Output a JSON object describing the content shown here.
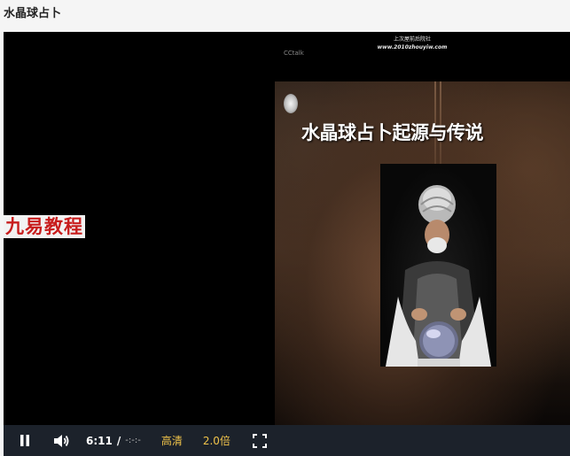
{
  "page": {
    "title": "水晶球占卜"
  },
  "slide": {
    "header_line1": "上次屋前后院社",
    "header_url": "www.2010zhouyiw.com",
    "watermark": "CCtalk",
    "title": "水晶球占卜起源与传说"
  },
  "brand": {
    "logo_text": "九易教程"
  },
  "controls": {
    "current_time": "6:11",
    "separator": "/",
    "total_time": "-:-:-",
    "quality_label": "高清",
    "speed_label": "2.0倍",
    "play_state": "playing",
    "icons": {
      "play": "pause-icon",
      "volume": "volume-icon",
      "fullscreen": "fullscreen-icon"
    }
  },
  "colors": {
    "controls_bg": "#1c222b",
    "accent": "#f0c34a",
    "logo_red": "#c81d1d"
  }
}
